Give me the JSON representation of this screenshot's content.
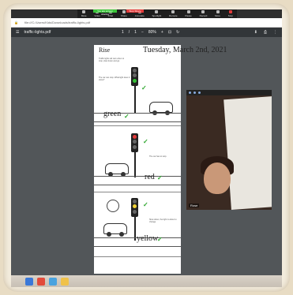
{
  "zoom_toolbar": {
    "share_pill": "You are screen sharing",
    "rec_pill": "Stop Share",
    "buttons": [
      {
        "label": "Mute",
        "icon": "mic-icon"
      },
      {
        "label": "Video",
        "icon": "camera-icon"
      },
      {
        "label": "Chat",
        "icon": "chat-icon"
      },
      {
        "label": "Share",
        "icon": "share-icon"
      },
      {
        "label": "Annotate",
        "icon": "pen-icon"
      },
      {
        "label": "Spotlight",
        "icon": "spotlight-icon"
      },
      {
        "label": "Remote",
        "icon": "remote-icon"
      },
      {
        "label": "Pause",
        "icon": "pause-icon"
      },
      {
        "label": "Record",
        "icon": "record-icon"
      },
      {
        "label": "More",
        "icon": "more-icon"
      },
      {
        "label": "Stop",
        "icon": "stop-icon"
      }
    ]
  },
  "browser": {
    "url": "file:///C:/Users/Kids/Downloads/traffic-lights.pdf"
  },
  "pdf_toolbar": {
    "title": "traffic-lights.pdf",
    "page_current": "1",
    "page_total": "1",
    "zoom": "80%"
  },
  "worksheet": {
    "name": "Rise",
    "date": "Tuesday, March 2nd, 2021",
    "intro_note": "Traffic lights tell cars when to stop, slow down and go.",
    "q_note": "The car can stop. What light does it show?",
    "word_green": "green",
    "word_red": "red",
    "word_yellow": "yellow",
    "red_note": "The car has to stop.",
    "yellow_note": "Slow down, the light is about to change."
  },
  "video": {
    "name": "Rose"
  },
  "colors": {
    "accent_green": "#2ea62e",
    "rec_red": "#e23b3b"
  }
}
